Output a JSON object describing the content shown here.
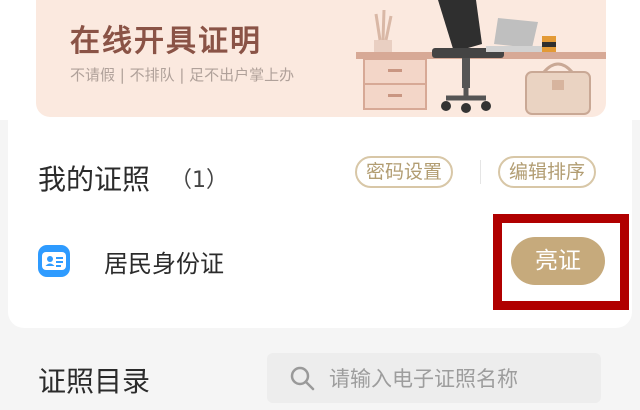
{
  "banner": {
    "title": "在线开具证明",
    "subtitle": "不请假 | 不排队 | 足不出户掌上办"
  },
  "my_licenses": {
    "title": "我的证照",
    "count": "（1）",
    "password_button": "密码设置",
    "sort_button": "编辑排序",
    "items": [
      {
        "label": "居民身份证",
        "action": "亮证",
        "icon": "id-card-icon"
      }
    ]
  },
  "catalog": {
    "title": "证照目录",
    "search_placeholder": "请输入电子证照名称"
  },
  "colors": {
    "banner_bg": "#fbe9df",
    "accent_gold": "#c6aa7c",
    "highlight_red": "#b00000",
    "icon_blue": "#2e9bff"
  }
}
